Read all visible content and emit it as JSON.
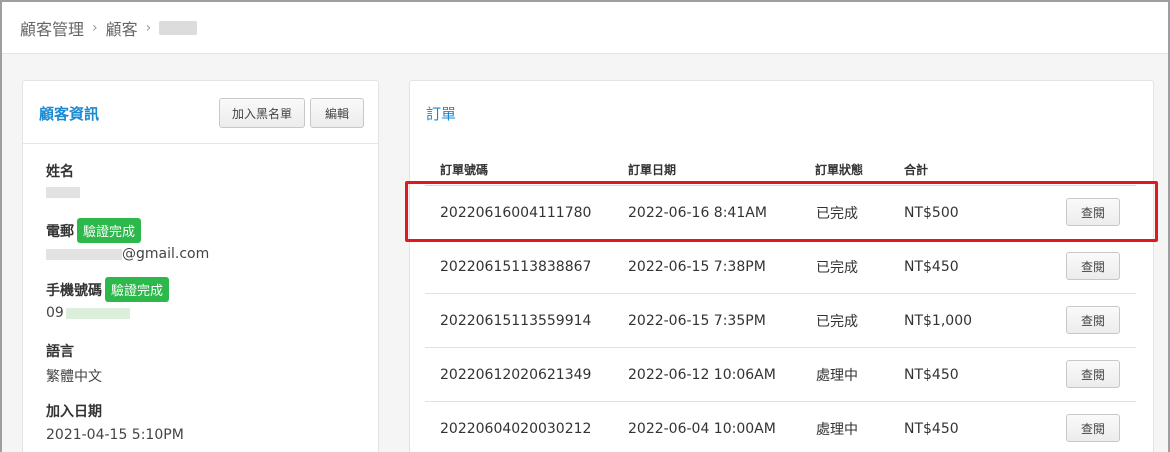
{
  "breadcrumb": {
    "items": [
      "顧客管理",
      "顧客"
    ],
    "separator": "›"
  },
  "customer_panel": {
    "title": "顧客資訊",
    "blacklist_label": "加入黑名單",
    "edit_label": "編輯",
    "name_label": "姓名",
    "email_label": "電郵",
    "email_badge": "驗證完成",
    "email_suffix": "@gmail.com",
    "phone_label": "手機號碼",
    "phone_badge": "驗證完成",
    "phone_prefix": "09",
    "language_label": "語言",
    "language_value": "繁體中文",
    "join_date_label": "加入日期",
    "join_date_value": "2021-04-15 5:10PM"
  },
  "orders_panel": {
    "title": "訂單",
    "columns": [
      "訂單號碼",
      "訂單日期",
      "訂單狀態",
      "合計"
    ],
    "view_label": "查閱",
    "rows": [
      {
        "number": "20220616004111780",
        "date": "2022-06-16 8:41AM",
        "status": "已完成",
        "total": "NT$500"
      },
      {
        "number": "20220615113838867",
        "date": "2022-06-15 7:38PM",
        "status": "已完成",
        "total": "NT$450"
      },
      {
        "number": "20220615113559914",
        "date": "2022-06-15 7:35PM",
        "status": "已完成",
        "total": "NT$1,000"
      },
      {
        "number": "20220612020621349",
        "date": "2022-06-12 10:06AM",
        "status": "處理中",
        "total": "NT$450"
      },
      {
        "number": "20220604020030212",
        "date": "2022-06-04 10:00AM",
        "status": "處理中",
        "total": "NT$450"
      }
    ]
  },
  "colors": {
    "accent": "#1a8ad4",
    "badge_green": "#2cb84a",
    "highlight_red": "#e0191d"
  }
}
